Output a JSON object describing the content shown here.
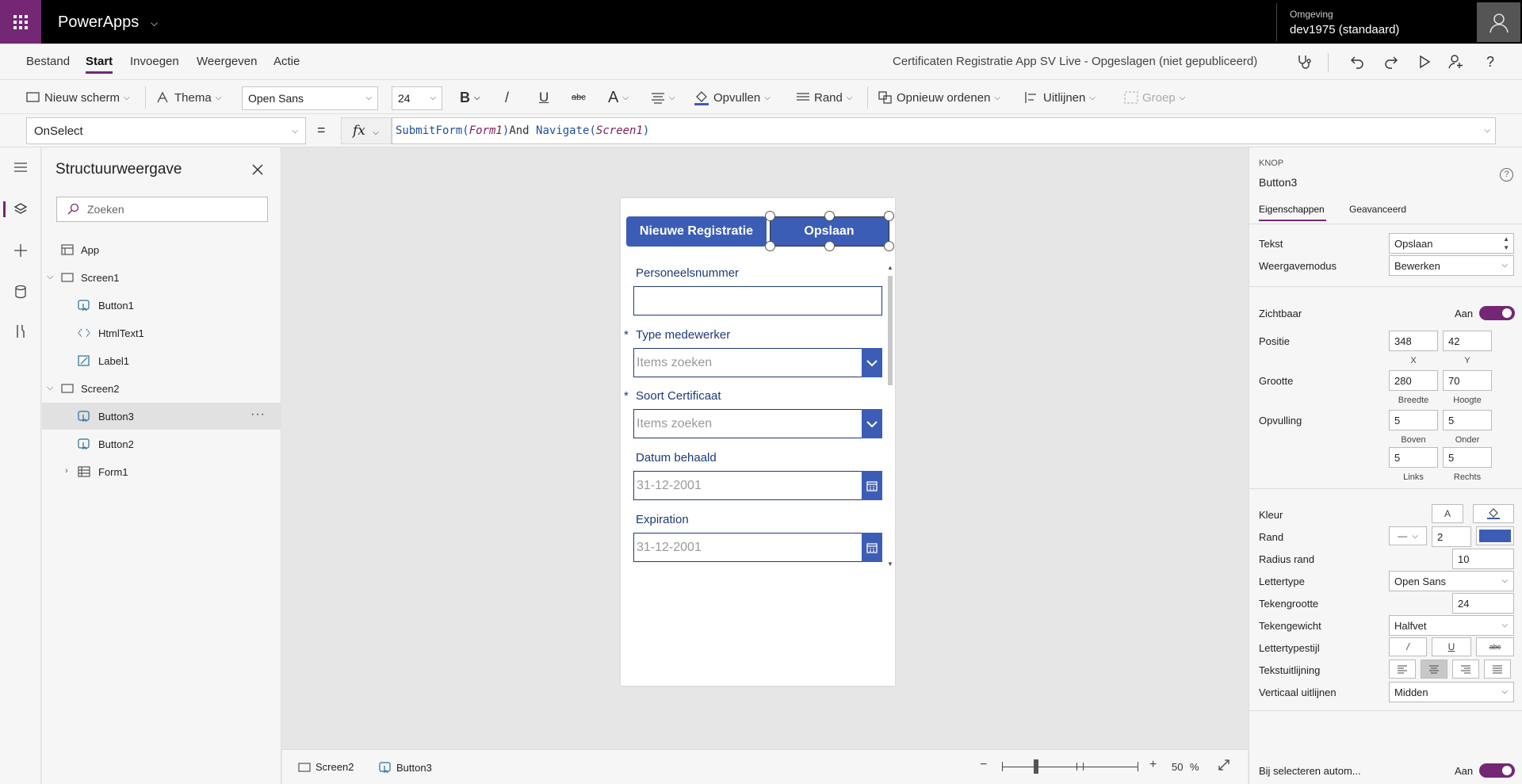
{
  "topbar": {
    "app_name": "PowerApps",
    "environment_label": "Omgeving",
    "environment_value": "dev1975 (standaard)"
  },
  "menu": {
    "items": [
      "Bestand",
      "Start",
      "Invoegen",
      "Weergeven",
      "Actie"
    ],
    "active": "Start",
    "doc_title": "Certificaten Registratie App SV Live - Opgeslagen (niet gepubliceerd)"
  },
  "toolbar": {
    "new_screen": "Nieuw scherm",
    "theme": "Thema",
    "font": "Open Sans",
    "font_size": "24",
    "bold": "B",
    "italic": "/",
    "underline": "U",
    "strike": "abc",
    "font_color": "A",
    "fill": "Opvullen",
    "border": "Rand",
    "reorder": "Opnieuw ordenen",
    "align": "Uitlijnen",
    "group": "Groep"
  },
  "formula_bar": {
    "property": "OnSelect",
    "equals": "=",
    "fx": "fx",
    "formula": {
      "fn1": "SubmitForm(",
      "arg1": "Form1",
      "close1": ")",
      "op": "And",
      "fn2": " Navigate(",
      "arg2": "Screen1",
      "close2": ")"
    }
  },
  "tree": {
    "title": "Structuurweergave",
    "search_placeholder": "Zoeken",
    "rows": [
      {
        "label": "App"
      },
      {
        "label": "Screen1"
      },
      {
        "label": "Button1"
      },
      {
        "label": "HtmlText1"
      },
      {
        "label": "Label1"
      },
      {
        "label": "Screen2"
      },
      {
        "label": "Button3"
      },
      {
        "label": "Button2"
      },
      {
        "label": "Form1"
      }
    ],
    "more": "···"
  },
  "screen": {
    "btn_new": "Nieuwe Registratie",
    "btn_save": "Opslaan",
    "fields": [
      {
        "label": "Personeelsnummer",
        "required": false,
        "value": ""
      },
      {
        "label": "Type medewerker",
        "required": true,
        "value": "Items zoeken"
      },
      {
        "label": "Soort Certificaat",
        "required": true,
        "value": "Items zoeken"
      },
      {
        "label": "Datum behaald",
        "required": false,
        "value": "31-12-2001"
      },
      {
        "label": "Expiration",
        "required": false,
        "value": "31-12-2001"
      }
    ],
    "required_mark": "*"
  },
  "statusbar": {
    "screen": "Screen2",
    "control": "Button3",
    "zoom": "50",
    "zoom_unit": "%"
  },
  "props": {
    "type": "KNOP",
    "name": "Button3",
    "tabs": [
      "Eigenschappen",
      "Geavanceerd"
    ],
    "text_label": "Tekst",
    "text_value": "Opslaan",
    "mode_label": "Weergavemodus",
    "mode_value": "Bewerken",
    "visible_label": "Zichtbaar",
    "on": "Aan",
    "position_label": "Positie",
    "pos_x": "348",
    "pos_y": "42",
    "x": "X",
    "y": "Y",
    "size_label": "Grootte",
    "width": "280",
    "height": "70",
    "width_label": "Breedte",
    "height_label": "Hoogte",
    "padding_label": "Opvulling",
    "pad_top": "5",
    "pad_bottom": "5",
    "pad_left": "5",
    "pad_right": "5",
    "top_label": "Boven",
    "bottom_label": "Onder",
    "left_label": "Links",
    "right_label": "Rechts",
    "color_label": "Kleur",
    "color_a": "A",
    "border_label": "Rand",
    "border_width": "2",
    "border_color": "#3b5db6",
    "radius_label": "Radius rand",
    "radius": "10",
    "font_label": "Lettertype",
    "font_value": "Open Sans",
    "font_size_label": "Tekengrootte",
    "font_size": "24",
    "weight_label": "Tekengewicht",
    "weight_value": "Halfvet",
    "style_label": "Lettertypestijl",
    "align_label": "Tekstuitlijning",
    "valign_label": "Verticaal uitlijnen",
    "valign_value": "Midden",
    "autoselect_label": "Bij selecteren autom..."
  },
  "colors": {
    "accent": "#742774",
    "button": "#3b5db6",
    "form_label": "#1c3a78"
  }
}
